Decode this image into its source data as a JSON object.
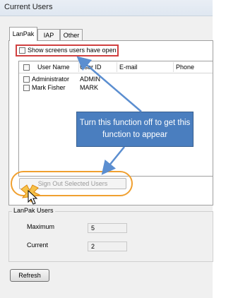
{
  "window": {
    "title": "Current Users"
  },
  "tabs": [
    {
      "label": "LanPak",
      "active": true
    },
    {
      "label": "IAP",
      "active": false
    },
    {
      "label": "Other",
      "active": false
    }
  ],
  "show_screens": {
    "label": "Show screens users have open",
    "checked": false
  },
  "users_list": {
    "columns": [
      "User Name",
      "User ID",
      "E-mail",
      "Phone"
    ],
    "rows": [
      {
        "name": "Administrator",
        "id": "ADMIN",
        "email": "",
        "phone": "",
        "checked": false
      },
      {
        "name": "Mark Fisher",
        "id": "MARK",
        "email": "",
        "phone": "",
        "checked": false
      }
    ]
  },
  "callout": {
    "text": "Turn this function off to get this function to appear"
  },
  "sign_out_button": {
    "label": "Sign Out Selected Users",
    "enabled": false
  },
  "lanpak_users": {
    "title": "LanPak Users",
    "maximum_label": "Maximum",
    "maximum_value": "5",
    "current_label": "Current",
    "current_value": "2"
  },
  "refresh_button": {
    "label": "Refresh"
  },
  "colors": {
    "callout_fill": "#4a7ebf",
    "highlight_red": "#d04040",
    "highlight_orange": "#f0a030",
    "arrow_blue": "#5b8ed0"
  },
  "icons": [
    "arrow-annotation",
    "cursor-click-icon"
  ]
}
